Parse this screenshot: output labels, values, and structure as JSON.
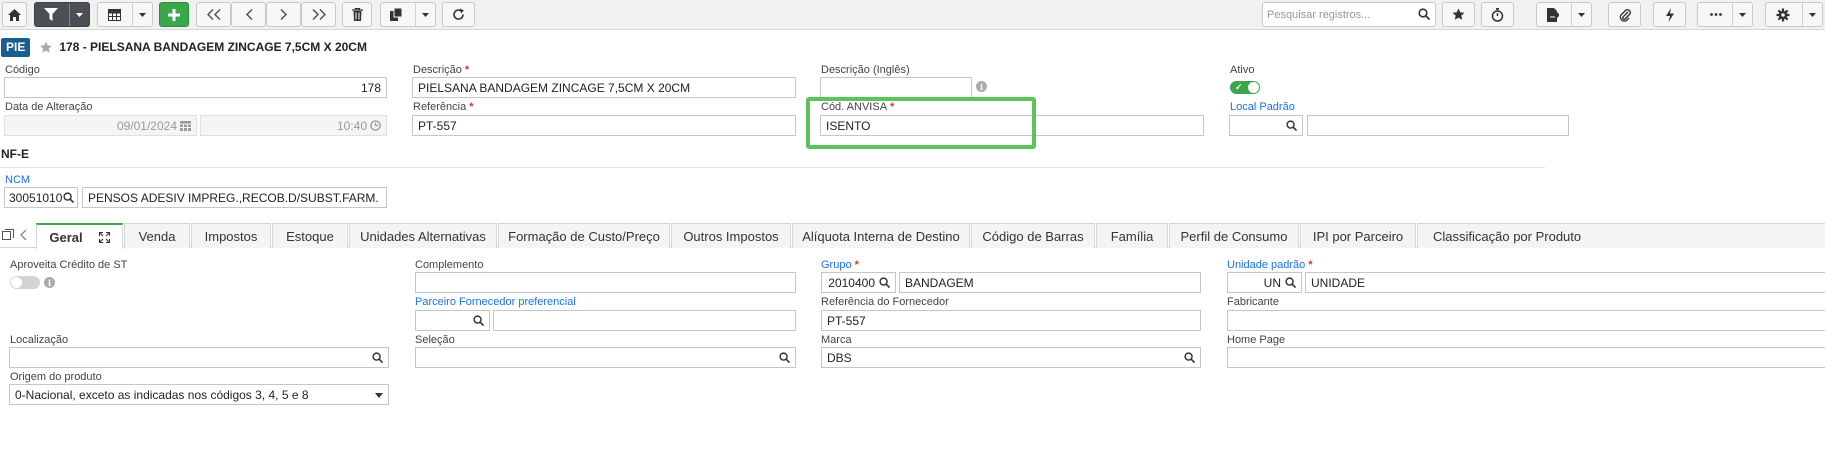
{
  "toolbar": {
    "search_placeholder": "Pesquisar registros...",
    "buttons": [
      "home-icon",
      "filter-icon",
      "grid-icon",
      "add-icon",
      "first-icon",
      "prev-icon",
      "next-icon",
      "last-icon",
      "trash-icon",
      "copy-icon",
      "refresh-icon",
      "star-icon",
      "clock-icon",
      "export-icon",
      "attach-icon",
      "bolt-icon",
      "more-icon",
      "gear-icon"
    ]
  },
  "record": {
    "badge": "PIE",
    "title": "178 - PIELSANA BANDAGEM ZINCAGE 7,5CM X 20CM"
  },
  "form": {
    "codigo": {
      "label": "Código",
      "value": "178"
    },
    "data_alteracao": {
      "label": "Data de Alteração",
      "date": "09/01/2024",
      "time": "10:40"
    },
    "descricao": {
      "label": "Descrição",
      "required": "*",
      "value": "PIELSANA BANDAGEM ZINCAGE 7,5CM X 20CM"
    },
    "referencia": {
      "label": "Referência",
      "required": "*",
      "value": "PT-557"
    },
    "descricao_ingles": {
      "label": "Descrição (Inglês)",
      "value": ""
    },
    "cod_anvisa": {
      "label": "Cód. ANVISA",
      "required": "*",
      "value": "ISENTO"
    },
    "ativo": {
      "label": "Ativo",
      "state": "on",
      "check": "✓"
    },
    "local_padrao": {
      "label": "Local Padrão",
      "code": "",
      "value": ""
    }
  },
  "nfe": {
    "section": "NF-E",
    "ncm": {
      "label": "NCM",
      "code": "30051010",
      "description": "PENSOS ADESIV IMPREG.,RECOB.D/SUBST.FARM."
    }
  },
  "tabs": [
    {
      "label": "Geral",
      "active": true
    },
    {
      "label": "Venda"
    },
    {
      "label": "Impostos"
    },
    {
      "label": "Estoque"
    },
    {
      "label": "Unidades Alternativas"
    },
    {
      "label": "Formação de Custo/Preço"
    },
    {
      "label": "Outros Impostos"
    },
    {
      "label": "Alíquota Interna de Destino"
    },
    {
      "label": "Código de Barras"
    },
    {
      "label": "Família"
    },
    {
      "label": "Perfil de Consumo"
    },
    {
      "label": "IPI por Parceiro"
    },
    {
      "label": "Classificação por Produto"
    }
  ],
  "geral": {
    "aproveita_credito": {
      "label": "Aproveita Crédito de ST",
      "state": "off"
    },
    "complemento": {
      "label": "Complemento",
      "value": ""
    },
    "grupo": {
      "label": "Grupo",
      "required": "*",
      "code": "2010400",
      "value": "BANDAGEM"
    },
    "unidade_padrao": {
      "label": "Unidade padrão",
      "required": "*",
      "code": "UN",
      "value": "UNIDADE"
    },
    "parceiro_fornecedor": {
      "label": "Parceiro Fornecedor preferencial",
      "code": "",
      "value": ""
    },
    "referencia_fornecedor": {
      "label": "Referência do Fornecedor",
      "value": "PT-557"
    },
    "fabricante": {
      "label": "Fabricante",
      "value": ""
    },
    "localizacao": {
      "label": "Localização",
      "value": ""
    },
    "selecao": {
      "label": "Seleção",
      "value": ""
    },
    "marca": {
      "label": "Marca",
      "value": "DBS"
    },
    "home_page": {
      "label": "Home Page",
      "value": ""
    },
    "origem": {
      "label": "Origem do produto",
      "value": "0-Nacional, exceto as indicadas nos códigos 3, 4, 5 e 8"
    }
  },
  "colors": {
    "accent": "#3aa84a",
    "badge": "#1a5d8f",
    "link": "#1a73e8",
    "required": "#d9322f",
    "highlight": "#5ac35a"
  }
}
